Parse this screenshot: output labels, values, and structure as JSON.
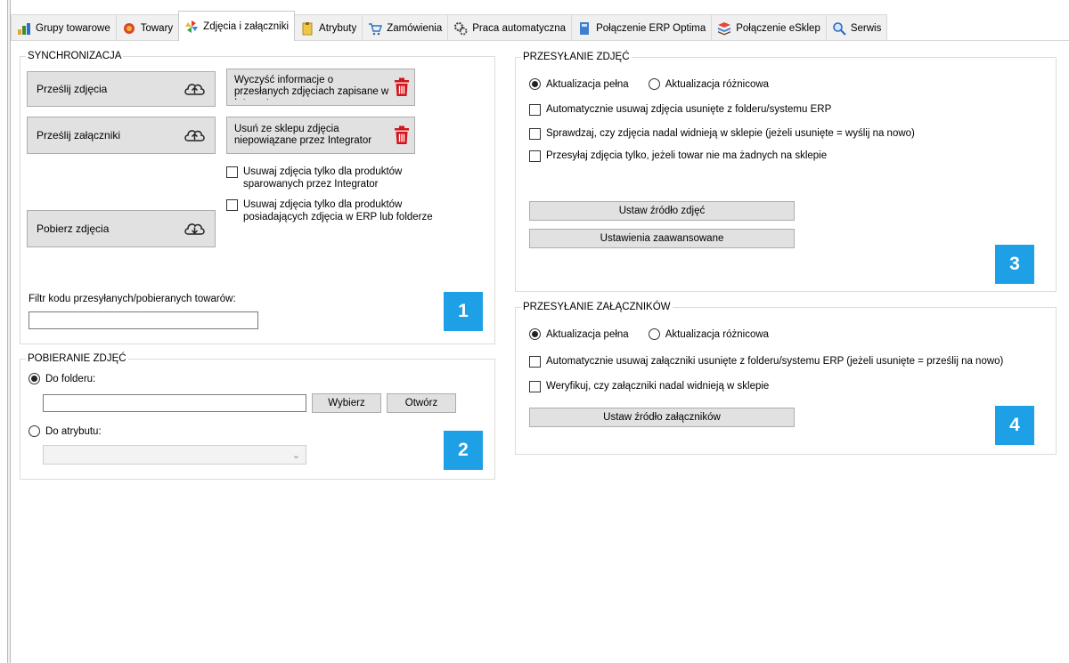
{
  "tabs": [
    {
      "label": "Grupy towarowe",
      "icon": "product-groups-icon",
      "active": false
    },
    {
      "label": "Towary",
      "icon": "products-icon",
      "active": false
    },
    {
      "label": "Zdjęcia i załączniki",
      "icon": "pinwheel-icon",
      "active": true
    },
    {
      "label": "Atrybuty",
      "icon": "attributes-icon",
      "active": false
    },
    {
      "label": "Zamówienia",
      "icon": "cart-icon",
      "active": false
    },
    {
      "label": "Praca automatyczna",
      "icon": "gears-icon",
      "active": false
    },
    {
      "label": "Połączenie ERP Optima",
      "icon": "book-icon",
      "active": false
    },
    {
      "label": "Połączenie eSklep",
      "icon": "stack-icon",
      "active": false
    },
    {
      "label": "Serwis",
      "icon": "magnifier-icon",
      "active": false
    }
  ],
  "sync": {
    "legend": "SYNCHRONIZACJA",
    "upload_images": "Prześlij zdjęcia",
    "upload_attachments": "Prześlij załączniki",
    "download_images": "Pobierz zdjęcia",
    "clear_info": "Wyczyść informacje o przesłanych zdjęciach zapisane w Integratorze",
    "remove_unlinked": "Usuń ze sklepu zdjęcia niepowiązane przez Integrator",
    "chk_paired": "Usuwaj zdjęcia tylko dla produktów sparowanych przez Integrator",
    "chk_has_images": "Usuwaj zdjęcia tylko dla produktów posiadających zdjęcia w ERP lub folderze",
    "filter_label": "Filtr kodu przesyłanych/pobieranych towarów:",
    "filter_value": "",
    "badge": "1"
  },
  "download": {
    "legend": "POBIERANIE ZDJĘĆ",
    "to_folder": "Do folderu:",
    "folder_value": "",
    "choose": "Wybierz",
    "open": "Otwórz",
    "to_attribute": "Do atrybutu:",
    "attribute_value": "",
    "selected": "folder",
    "badge": "2"
  },
  "images": {
    "legend": "PRZESYŁANIE ZDJĘĆ",
    "full": "Aktualizacja pełna",
    "diff": "Aktualizacja różnicowa",
    "selected": "full",
    "chk_auto_remove": "Automatycznie usuwaj zdjęcia usunięte z folderu/systemu ERP",
    "chk_verify": "Sprawdzaj, czy zdjęcia nadal widnieją w sklepie (jeżeli usunięte = wyślij na nowo)",
    "chk_only_none": "Przesyłaj zdjęcia tylko, jeżeli towar nie ma żadnych na sklepie",
    "set_source": "Ustaw źródło zdjęć",
    "advanced": "Ustawienia zaawansowane",
    "badge": "3"
  },
  "attachments": {
    "legend": "PRZESYŁANIE ZAŁĄCZNIKÓW",
    "full": "Aktualizacja pełna",
    "diff": "Aktualizacja różnicowa",
    "selected": "full",
    "chk_auto_remove": "Automatycznie usuwaj załączniki usunięte z folderu/systemu ERP (jeżeli usunięte = prześlij na nowo)",
    "chk_verify": "Weryfikuj, czy załączniki nadal widnieją w sklepie",
    "set_source": "Ustaw źródło załączników",
    "badge": "4"
  },
  "colors": {
    "badge": "#1ea0e6",
    "trash": "#d4141b"
  }
}
